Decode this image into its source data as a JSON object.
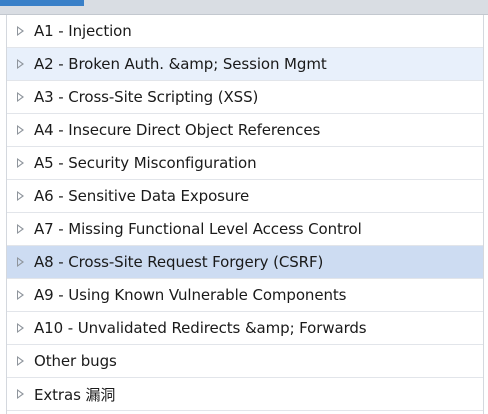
{
  "menu": {
    "items": [
      {
        "label": "A1 - Injection",
        "state": "normal"
      },
      {
        "label": "A2 - Broken Auth. &amp; Session Mgmt",
        "state": "hover"
      },
      {
        "label": "A3 - Cross-Site Scripting (XSS)",
        "state": "normal"
      },
      {
        "label": "A4 - Insecure Direct Object References",
        "state": "normal"
      },
      {
        "label": "A5 - Security Misconfiguration",
        "state": "normal"
      },
      {
        "label": "A6 - Sensitive Data Exposure",
        "state": "normal"
      },
      {
        "label": "A7 - Missing Functional Level Access Control",
        "state": "normal"
      },
      {
        "label": "A8 - Cross-Site Request Forgery (CSRF)",
        "state": "selected"
      },
      {
        "label": "A9 - Using Known Vulnerable Components",
        "state": "normal"
      },
      {
        "label": "A10 - Unvalidated Redirects &amp; Forwards",
        "state": "normal"
      },
      {
        "label": "Other bugs",
        "state": "normal"
      },
      {
        "label": "Extras 漏洞",
        "state": "normal"
      }
    ]
  },
  "icons": {
    "expander": "triangle-right-icon"
  },
  "colors": {
    "hover_background": "#e8f0fb",
    "selected_background": "#cddcf2",
    "accent": "#3a80c8"
  }
}
